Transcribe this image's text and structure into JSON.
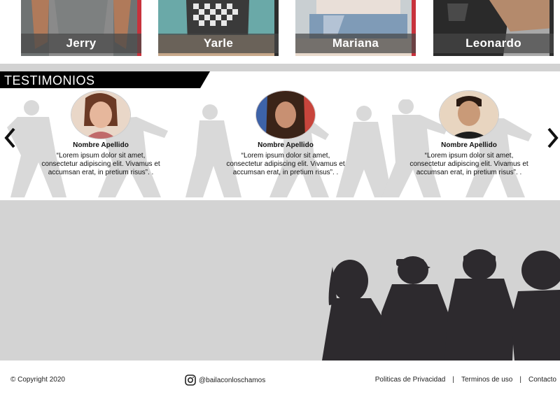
{
  "instructors": [
    {
      "name": "Jerry"
    },
    {
      "name": "Yarle"
    },
    {
      "name": "Mariana"
    },
    {
      "name": "Leonardo"
    }
  ],
  "testimonials_section": {
    "title": "TESTIMONIOS",
    "items": [
      {
        "name": "Nombre Apellido",
        "quote": "“Lorem ipsum dolor sit amet, consectetur adipiscing elit. Vivamus et accumsan erat, in pretium risus”. ."
      },
      {
        "name": "Nombre Apellido",
        "quote": "“Lorem ipsum dolor sit amet, consectetur adipiscing elit. Vivamus et accumsan erat, in pretium risus”. ."
      },
      {
        "name": "Nombre Apellido",
        "quote": "“Lorem ipsum dolor sit amet, consectetur adipiscing elit. Vivamus et accumsan erat, in pretium risus”. ."
      }
    ],
    "prev_icon": "chevron-left-icon",
    "next_icon": "chevron-right-icon"
  },
  "footer": {
    "copyright": "© Copyright 2020",
    "instagram_icon": "instagram-icon",
    "instagram_handle": "@bailaconloschamos",
    "links": [
      "Politicas de Privacidad",
      "Terminos de uso",
      "Contacto"
    ],
    "separator": "|"
  },
  "colors": {
    "accent_red": "#c8323c",
    "title_bar": "#000000",
    "banner_gray": "#d3d3d3",
    "silhouette": "#2d2a2e"
  }
}
